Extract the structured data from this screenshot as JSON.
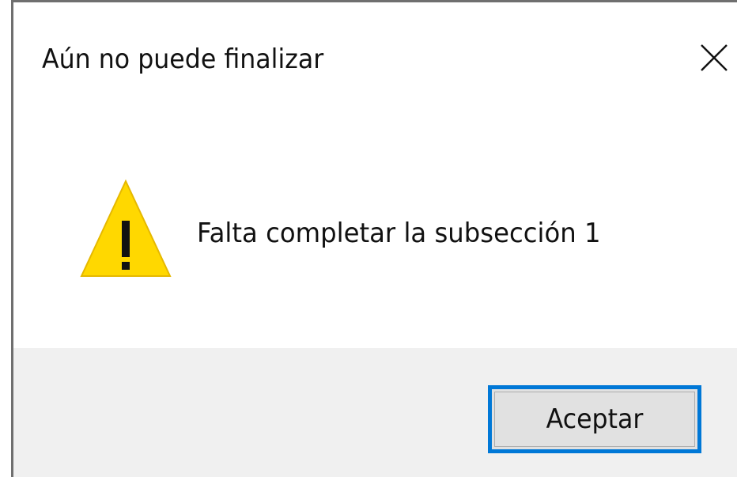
{
  "dialog": {
    "title": "Aún no puede finalizar",
    "close_icon": "close-icon",
    "message": "Falta completar la subsección 1",
    "icon": "warning-icon",
    "ok_label": "Aceptar"
  },
  "colors": {
    "accent": "#0078d7",
    "warning_fill": "#ffd800",
    "footer_bg": "#f0f0f0",
    "button_bg": "#e1e1e1",
    "frame": "#6f6f6f"
  }
}
